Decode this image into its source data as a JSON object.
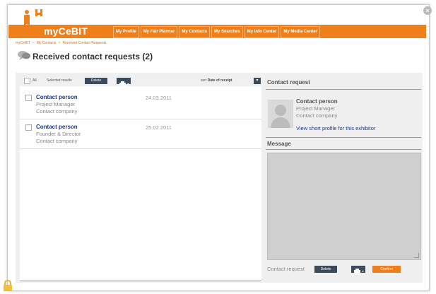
{
  "app": {
    "brand": "myCeBIT",
    "close_glyph": "×",
    "accent_color": "#ee7f1a",
    "dark_button_color": "#3a4b5c",
    "link_color": "#1d3a8a"
  },
  "nav": {
    "items": [
      {
        "label": "My Profile"
      },
      {
        "label": "My Fair Planner"
      },
      {
        "label": "My Contacts"
      },
      {
        "label": "My Searches"
      },
      {
        "label": "My Info Center"
      },
      {
        "label": "My Media Center"
      }
    ]
  },
  "breadcrumb": {
    "items": [
      "myCeBIT",
      "My Contacts",
      "Received Contact Requests"
    ],
    "separator": ">"
  },
  "page": {
    "title": "Received contact requests (2)",
    "icon": "speech-bubbles-icon"
  },
  "list_toolbar": {
    "all_label": "All",
    "selected_label": "Selected results",
    "delete_label": "Delete",
    "sort_prefix": "sort",
    "sort_value": "Date of receipt",
    "sort_glyph": "▾"
  },
  "requests": [
    {
      "name": "Contact person",
      "role": "Project Manager",
      "company": "Contact company",
      "date": "24.03.2011"
    },
    {
      "name": "Contact person",
      "role": "Founder & Director",
      "company": "Contact company",
      "date": "25.02.2011"
    }
  ],
  "detail": {
    "title": "Contact request",
    "name": "Contact person",
    "role": "Project Manager",
    "company": "Contact company",
    "profile_link": "View short profile for this exhibitor",
    "message_title": "Message",
    "message_text": "",
    "footer_label": "Contact request",
    "delete_label": "Delete",
    "confirm_label": "Confirm"
  }
}
